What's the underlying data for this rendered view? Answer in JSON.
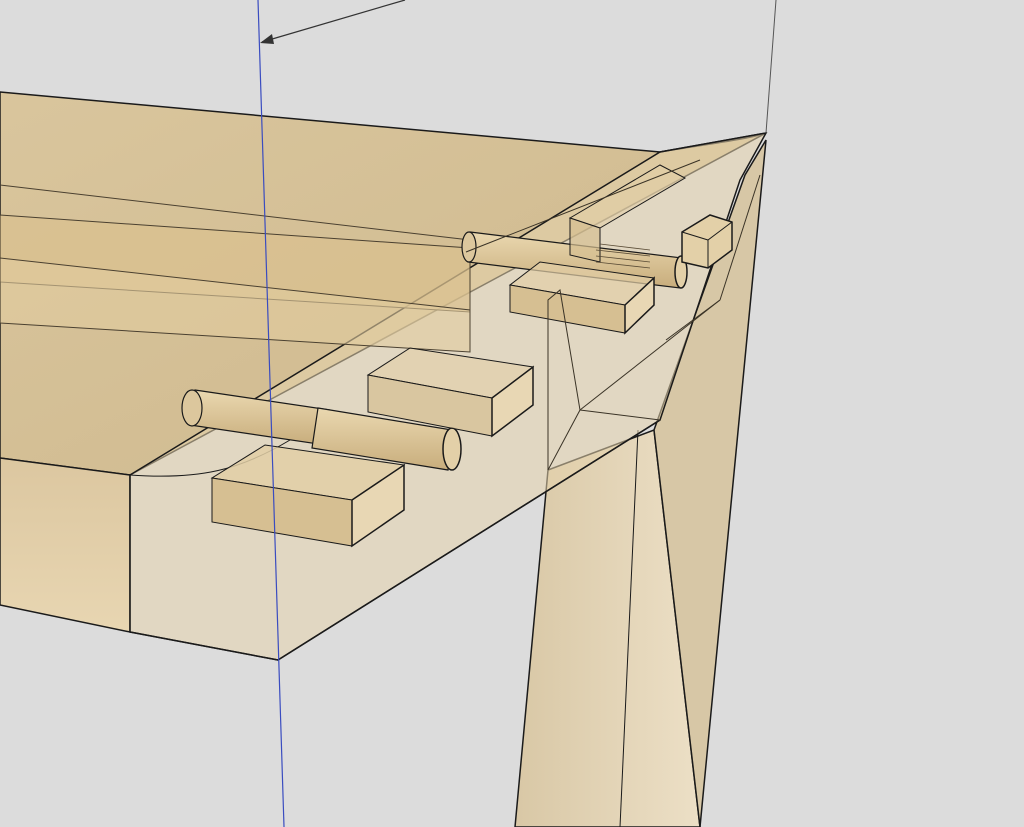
{
  "viewport": {
    "background": "#dcdcdc",
    "model": "table-corner-joinery",
    "colors": {
      "wood_light": "#e6d3ac",
      "wood_mid": "#d2bb8c",
      "wood_dark": "#b99d6c",
      "edge": "#1a1a1a",
      "axis_blue": "#3a4cc0"
    },
    "icons": [
      "dimension-arrow-icon"
    ]
  }
}
